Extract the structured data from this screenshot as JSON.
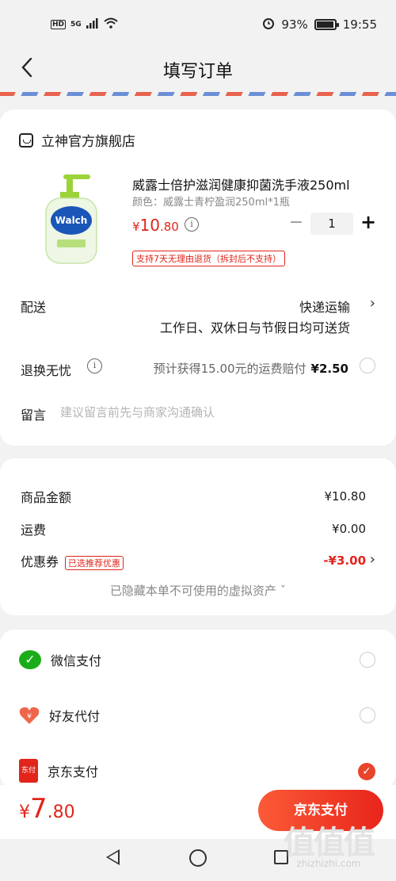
{
  "status_bar": {
    "left_labels": [
      "HD",
      "5G"
    ],
    "battery": "93%",
    "battery_level": 0.93,
    "time": "19:55"
  },
  "header": {
    "back_icon": "chevron-left-icon",
    "title": "填写订单"
  },
  "order": {
    "shop_name": "立神官方旗舰店",
    "product": {
      "title": "威露士倍护滋润健康抑菌洗手液250ml",
      "spec": "颜色：威露士青柠盈润250ml*1瓶",
      "price_symbol": "¥",
      "price_int": "10",
      "price_dec": ".80",
      "quantity": "1",
      "minus": "−",
      "plus": "+",
      "return_tag": "支持7天无理由退货（拆封后不支持）",
      "image_brand": "Walch"
    },
    "delivery": {
      "label": "配送",
      "method": "快递运输",
      "note": "工作日、双休日与节假日均可送货"
    },
    "exchange": {
      "label": "退换无忧",
      "text": "预计获得15.00元的运费赔付",
      "price": "¥2.50"
    },
    "remark": {
      "label": "留言",
      "placeholder": "建议留言前先与商家沟通确认"
    }
  },
  "amounts": {
    "goods_label": "商品金额",
    "goods_value": "¥10.80",
    "shipping_label": "运费",
    "shipping_value": "¥0.00",
    "coupon_label": "优惠券",
    "coupon_tag": "已选推荐优惠",
    "coupon_value": "-¥3.00",
    "hidden_note": "已隐藏本单不可使用的虚拟资产 ˇ"
  },
  "payment": {
    "options": [
      {
        "label": "微信支付",
        "icon": "wechat-icon",
        "selected": false
      },
      {
        "label": "好友代付",
        "icon": "friend-pay-icon",
        "selected": false
      },
      {
        "label": "京东支付",
        "icon": "jd-pay-icon",
        "selected": true
      }
    ],
    "jd_icon_text": "东付"
  },
  "bottom": {
    "total_symbol": "¥",
    "total_int": "7",
    "total_dec": ".80",
    "pay_button": "京东支付"
  },
  "watermark": {
    "big": "值值值",
    "small": "zhizhizhi.com"
  },
  "colors": {
    "accent": "#e1251b",
    "wechat": "#1aad19"
  }
}
